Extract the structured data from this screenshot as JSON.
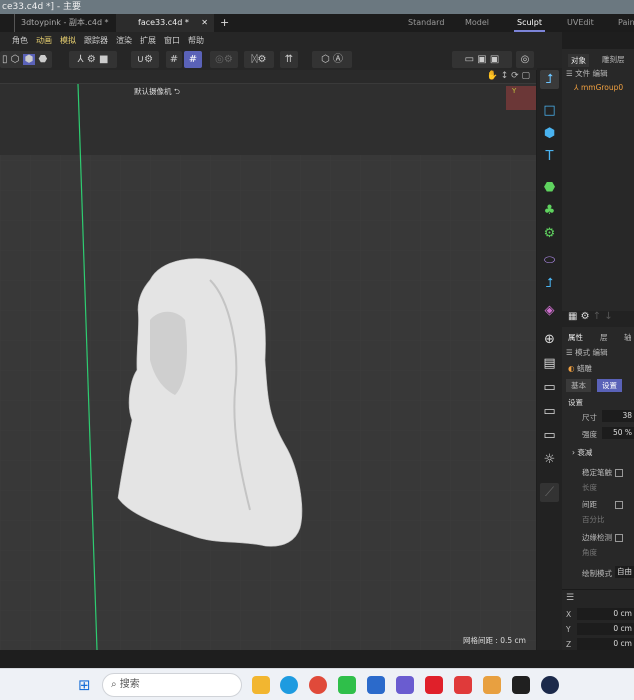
{
  "window": {
    "title": "ce33.c4d *] - 主要"
  },
  "tabs": [
    {
      "label": "3dtoypink - 副本.c4d *"
    },
    {
      "label": "face33.c4d *",
      "active": true
    }
  ],
  "layouts": [
    {
      "label": "Standard"
    },
    {
      "label": "Model"
    },
    {
      "label": "Sculpt",
      "active": true
    },
    {
      "label": "UVEdit"
    },
    {
      "label": "Pain"
    }
  ],
  "menu": [
    "角色",
    "动画",
    "模拟",
    "跟踪器",
    "渲染",
    "扩展",
    "窗口",
    "帮助"
  ],
  "viewport": {
    "camera": "默认摄像机",
    "grid_spacing": "网格间距 : 0.5 cm"
  },
  "objects_panel": {
    "tabs": [
      "对象",
      "雕刻层"
    ],
    "menu": [
      "文件",
      "编辑"
    ],
    "items": [
      "mmGroup0"
    ]
  },
  "attributes": {
    "tabs": [
      "属性",
      "层",
      "轴"
    ],
    "menu": [
      "模式",
      "编辑"
    ],
    "tool": "蜡雕",
    "subtabs": [
      "基本",
      "设置"
    ],
    "section": "设置",
    "size_label": "尺寸",
    "size": "38",
    "strength_label": "强度",
    "strength": "50 %",
    "falloff": "衰减",
    "stabilize": "稳定笔触",
    "length": "长度",
    "spacing": "间距",
    "percent": "百分比",
    "edge_detect": "边缘检测",
    "angle": "角度",
    "draw_mode_label": "绘制模式",
    "draw_mode": "自由"
  },
  "coords": [
    {
      "axis": "X",
      "value": "0 cm"
    },
    {
      "axis": "Y",
      "value": "0 cm"
    },
    {
      "axis": "Z",
      "value": "0 cm"
    }
  ],
  "taskbar": {
    "search_placeholder": "搜索"
  },
  "colors": {
    "accent": "#5a62b8",
    "axis_green": "#2ecc71",
    "icon_blue": "#4ab3f0"
  }
}
